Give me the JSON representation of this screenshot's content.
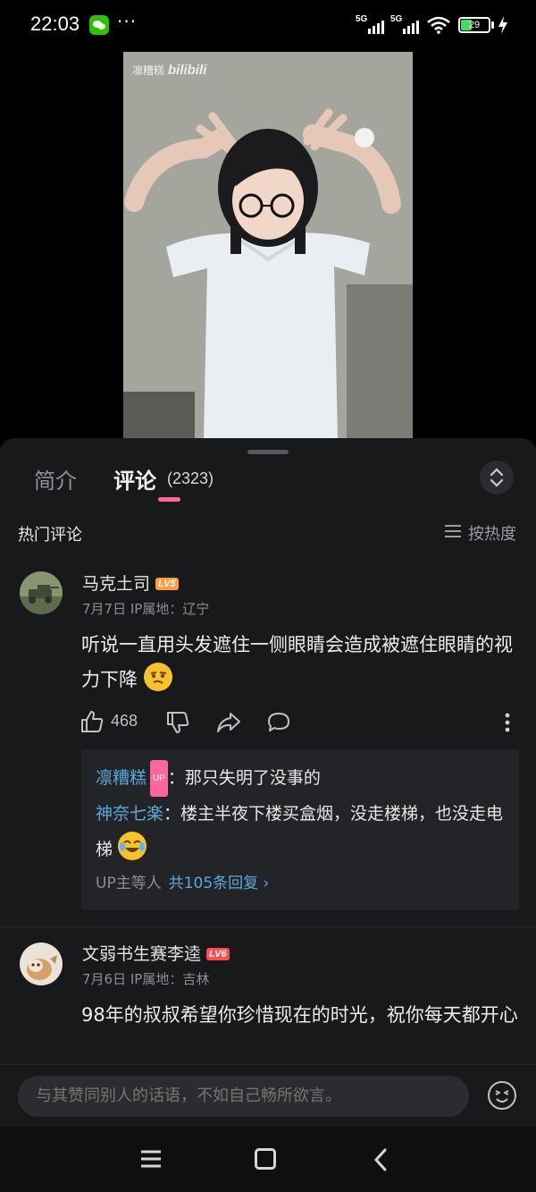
{
  "status_bar": {
    "time": "22:03",
    "dots": "···",
    "network_left": "5G",
    "network_right": "5G",
    "battery": "29"
  },
  "video": {
    "watermark_name": "凛糟糕",
    "watermark_logo": "bilibili"
  },
  "tabs": {
    "intro": "简介",
    "comments": "评论",
    "comments_count": "(2323)"
  },
  "comments_section": {
    "title": "热门评论",
    "sort_label": "按热度"
  },
  "comments": [
    {
      "username": "马克土司",
      "level": "LV5",
      "level_color": "#ff9a3d",
      "date": "7月7日",
      "ip": "IP属地：辽宁",
      "content": "听说一直用头发遮住一侧眼睛会造成被遮住眼睛的视力下降",
      "likes": "468",
      "replies": [
        {
          "name": "凛糟糕",
          "badge": "UP",
          "text": "：那只失明了没事的"
        },
        {
          "name": "神奈七楽",
          "text": "：楼主半夜下楼买盒烟，没走楼梯，也没走电梯"
        }
      ],
      "reply_summary": "UP主等人",
      "reply_more": "共105条回复 ›"
    },
    {
      "username": "文弱书生赛李逵",
      "level": "LV6",
      "level_color": "#ff4d4d",
      "date": "7月6日",
      "ip": "IP属地：吉林",
      "content": "98年的叔叔希望你珍惜现在的时光，祝你每天都开心"
    }
  ],
  "input": {
    "placeholder": "与其赞同别人的话语，不如自己畅所欲言。"
  },
  "colors": {
    "accent": "#ff6699",
    "link": "#5ca8dc",
    "panel_bg": "#18191b"
  }
}
